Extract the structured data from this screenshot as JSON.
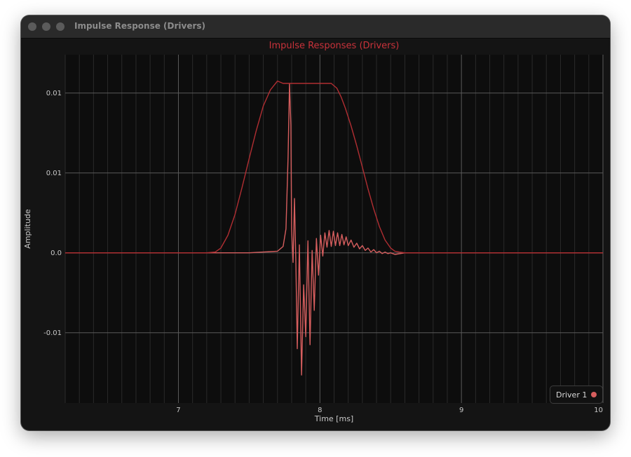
{
  "window": {
    "title": "Impulse Response (Drivers)"
  },
  "colors": {
    "title": "#c8323a",
    "envelope": "#b02e32",
    "impulse": "#d65e5e",
    "grid_major": "#5a5a5a",
    "grid_minor": "#2a2a2a",
    "tick_text": "#c8c8c8",
    "plot_bg": "#0d0d0d"
  },
  "chart_data": {
    "type": "line",
    "title": "Impulse Responses (Drivers)",
    "xlabel": "Time [ms]",
    "ylabel": "Amplitude",
    "xlim": [
      6.2,
      10.0
    ],
    "ylim": [
      -0.0188,
      0.0248
    ],
    "x_ticks": [
      7,
      8,
      9,
      10
    ],
    "x_tick_labels": [
      "7",
      "8",
      "9",
      "10"
    ],
    "y_ticks": [
      0.02,
      0.01,
      0.0,
      -0.01
    ],
    "y_tick_labels": [
      "0.01",
      "0.01",
      "0.0",
      "-0.01"
    ],
    "grid": true,
    "legend_position": "bottom-right",
    "series": [
      {
        "name": "Driver 1",
        "role": "impulse",
        "x": [
          6.2,
          7.5,
          7.7,
          7.74,
          7.76,
          7.775,
          7.785,
          7.795,
          7.8,
          7.81,
          7.82,
          7.83,
          7.84,
          7.855,
          7.87,
          7.885,
          7.9,
          7.915,
          7.93,
          7.945,
          7.96,
          7.975,
          7.99,
          8.005,
          8.02,
          8.035,
          8.05,
          8.065,
          8.08,
          8.095,
          8.11,
          8.125,
          8.14,
          8.155,
          8.17,
          8.185,
          8.2,
          8.22,
          8.24,
          8.26,
          8.28,
          8.3,
          8.32,
          8.34,
          8.36,
          8.38,
          8.4,
          8.42,
          8.44,
          8.46,
          8.48,
          8.5,
          8.53,
          8.6,
          10.0
        ],
        "y": [
          0.0,
          0.0,
          0.0002,
          0.0008,
          0.003,
          0.012,
          0.0212,
          0.016,
          0.003,
          -0.0012,
          0.0068,
          -0.0012,
          -0.012,
          0.001,
          -0.0153,
          -0.004,
          -0.0105,
          0.0015,
          -0.0115,
          0.0003,
          -0.0072,
          0.0018,
          -0.0028,
          0.0022,
          -0.0004,
          0.0025,
          0.0007,
          0.0028,
          0.0008,
          0.0027,
          0.0009,
          0.0025,
          0.0009,
          0.0023,
          0.001,
          0.002,
          0.0009,
          0.0016,
          0.0007,
          0.0012,
          0.0005,
          0.0009,
          0.0003,
          0.0006,
          0.0001,
          0.0004,
          0.0,
          0.0002,
          -0.0001,
          0.0001,
          -0.0001,
          0.0,
          -0.0002,
          0.0,
          0.0
        ]
      },
      {
        "role": "envelope",
        "x": [
          6.2,
          7.2,
          7.26,
          7.3,
          7.35,
          7.4,
          7.45,
          7.5,
          7.55,
          7.6,
          7.65,
          7.7,
          7.74,
          7.77,
          7.8,
          7.9,
          8.0,
          8.08,
          8.12,
          8.15,
          8.18,
          8.22,
          8.26,
          8.3,
          8.34,
          8.38,
          8.42,
          8.46,
          8.5,
          8.53,
          8.56,
          8.6,
          10.0
        ],
        "y": [
          0.0,
          0.0,
          0.0001,
          0.0006,
          0.0022,
          0.0048,
          0.0082,
          0.0118,
          0.0153,
          0.0184,
          0.0204,
          0.0215,
          0.0212,
          0.0212,
          0.0212,
          0.0212,
          0.0212,
          0.0212,
          0.0206,
          0.0195,
          0.0181,
          0.0159,
          0.0134,
          0.0107,
          0.008,
          0.0055,
          0.0033,
          0.0016,
          0.0006,
          0.0002,
          0.0001,
          0.0,
          0.0
        ]
      }
    ]
  },
  "legend": {
    "label": "Driver 1",
    "color": "#d65e5e"
  }
}
